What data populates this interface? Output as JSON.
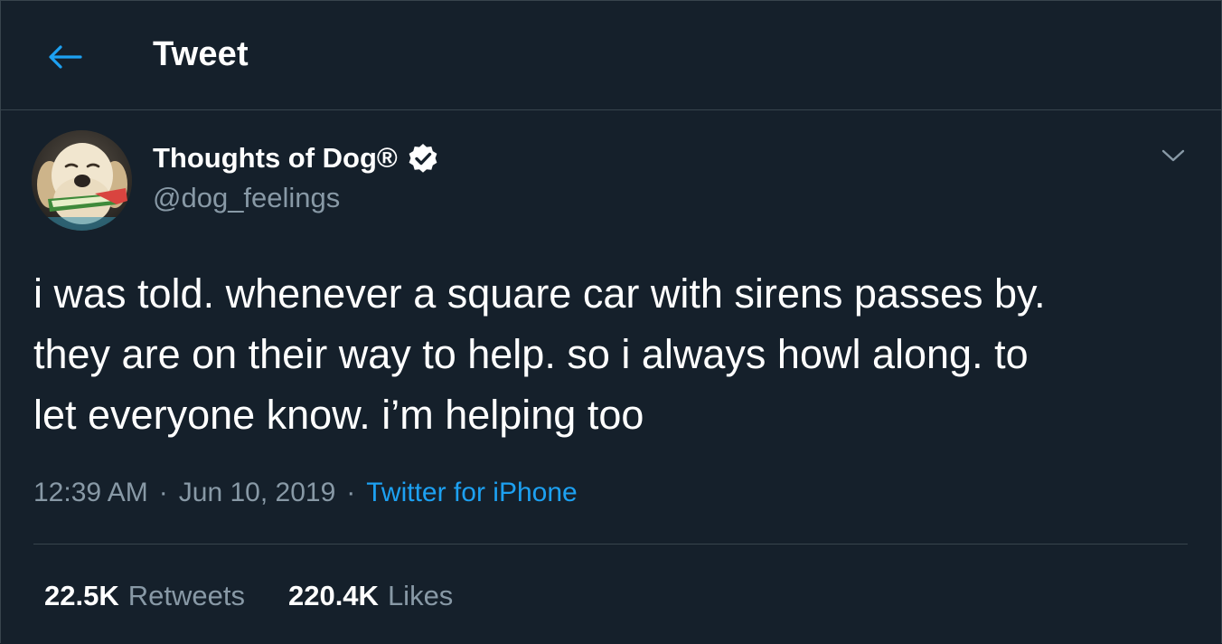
{
  "header": {
    "back_icon": "arrow-left-icon",
    "title": "Tweet"
  },
  "tweet": {
    "author": {
      "display_name": "Thoughts of Dog®",
      "handle": "@dog_feelings",
      "verified_icon": "verified-badge-icon"
    },
    "more_icon": "chevron-down-icon",
    "text": "i was told. whenever a square car with sirens passes by.\nthey are on their way to help. so i always howl along. to\nlet everyone know. i’m helping too",
    "time": "12:39 AM",
    "separator": "·",
    "date": "Jun 10, 2019",
    "source": "Twitter for iPhone",
    "stats": {
      "retweets_count": "22.5K",
      "retweets_label": "Retweets",
      "likes_count": "220.4K",
      "likes_label": "Likes"
    }
  },
  "colors": {
    "background": "#15202b",
    "border": "#38444d",
    "accent": "#1da1f2",
    "muted_text": "#8899a6",
    "primary_text": "#ffffff"
  }
}
